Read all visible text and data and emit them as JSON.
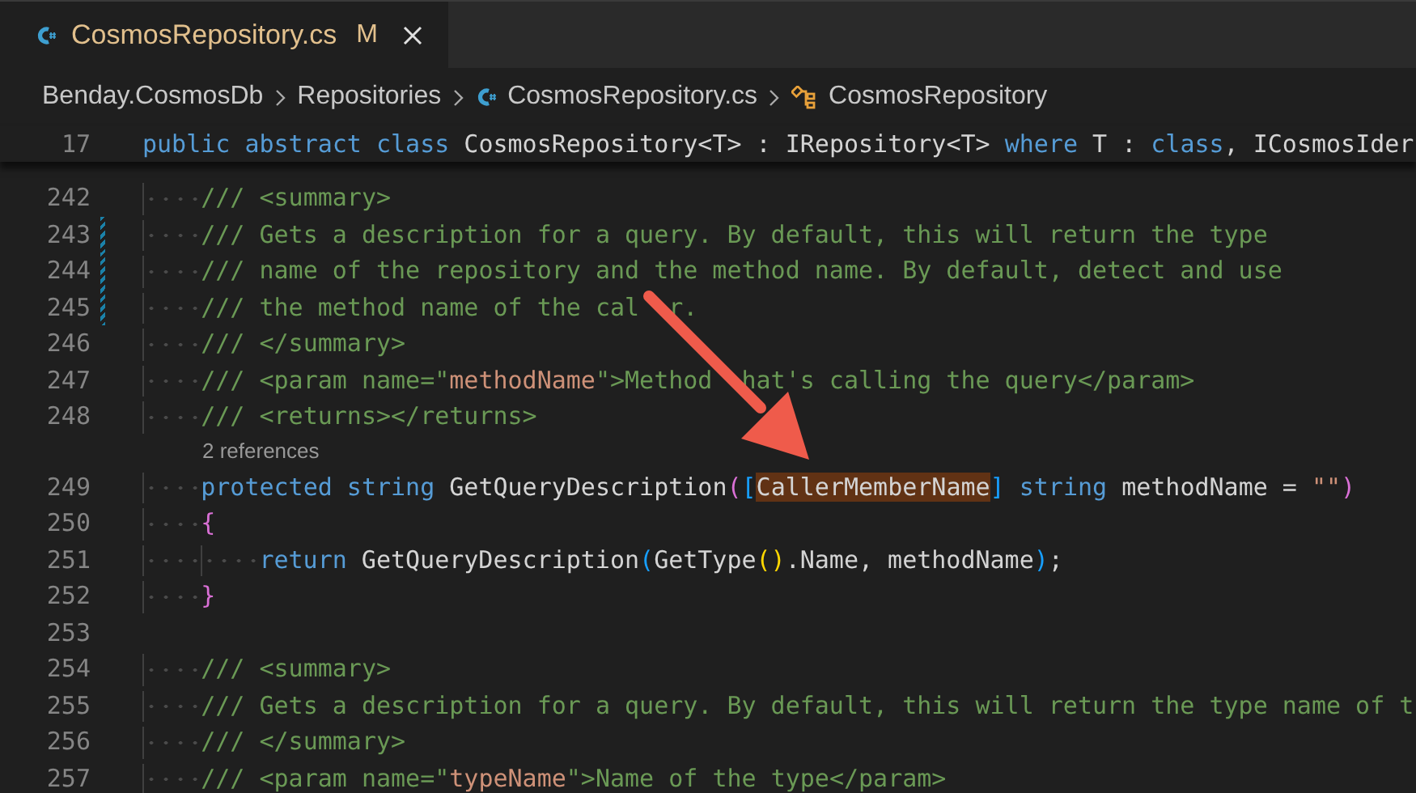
{
  "tab": {
    "label": "CosmosRepository.cs",
    "status": "M"
  },
  "breadcrumbs": [
    {
      "kind": "folder",
      "label": "Benday.CosmosDb"
    },
    {
      "kind": "folder",
      "label": "Repositories"
    },
    {
      "kind": "file",
      "label": "CosmosRepository.cs"
    },
    {
      "kind": "class",
      "label": "CosmosRepository"
    }
  ],
  "sticky_line": {
    "number": "17",
    "tokens": [
      {
        "kind": "keyword",
        "text": "public abstract class"
      },
      {
        "kind": "plain",
        "text": " CosmosRepository<T> : IRepository<T> "
      },
      {
        "kind": "keyword",
        "text": "where"
      },
      {
        "kind": "plain",
        "text": " T : "
      },
      {
        "kind": "keyword",
        "text": "class"
      },
      {
        "kind": "plain",
        "text": ", ICosmosIder"
      }
    ]
  },
  "lines": [
    {
      "number": "242",
      "modified": false,
      "tokens": [
        {
          "kind": "indent"
        },
        {
          "kind": "comment",
          "text": "/// <summary>"
        }
      ]
    },
    {
      "number": "243",
      "modified": true,
      "tokens": [
        {
          "kind": "indent"
        },
        {
          "kind": "comment",
          "text": "/// Gets a description for a query. By default, this will return the type"
        }
      ]
    },
    {
      "number": "244",
      "modified": true,
      "tokens": [
        {
          "kind": "indent"
        },
        {
          "kind": "comment",
          "text": "/// name of the repository and the method name. By default, detect and use"
        }
      ]
    },
    {
      "number": "245",
      "modified": true,
      "tokens": [
        {
          "kind": "indent"
        },
        {
          "kind": "comment",
          "text": "/// the method name of the cal"
        },
        {
          "kind": "covered"
        },
        {
          "kind": "covered"
        },
        {
          "kind": "comment",
          "text": "r."
        }
      ]
    },
    {
      "number": "246",
      "modified": false,
      "tokens": [
        {
          "kind": "indent"
        },
        {
          "kind": "comment",
          "text": "/// </summary>"
        }
      ]
    },
    {
      "number": "247",
      "modified": false,
      "tokens": [
        {
          "kind": "indent"
        },
        {
          "kind": "comment",
          "text": "/// <param name=\""
        },
        {
          "kind": "string",
          "text": "methodName"
        },
        {
          "kind": "comment",
          "text": "\">Method"
        },
        {
          "kind": "covered"
        },
        {
          "kind": "covered"
        },
        {
          "kind": "comment",
          "text": "hat's calling the query</param>"
        }
      ]
    },
    {
      "number": "248",
      "modified": false,
      "tokens": [
        {
          "kind": "indent"
        },
        {
          "kind": "comment",
          "text": "/// <returns></returns>"
        }
      ]
    },
    {
      "number": "249",
      "modified": false,
      "references": "2 references",
      "tokens": [
        {
          "kind": "indent"
        },
        {
          "kind": "keyword",
          "text": "protected string"
        },
        {
          "kind": "plain",
          "text": " GetQueryDescription"
        },
        {
          "kind": "brace",
          "text": "("
        },
        {
          "kind": "bracket",
          "text": "["
        },
        {
          "kind": "match",
          "text": "CallerMemberName"
        },
        {
          "kind": "bracket",
          "text": "]"
        },
        {
          "kind": "keyword",
          "text": " string"
        },
        {
          "kind": "plain",
          "text": " methodName = "
        },
        {
          "kind": "string",
          "text": "\"\""
        },
        {
          "kind": "brace",
          "text": ")"
        }
      ]
    },
    {
      "number": "250",
      "modified": false,
      "tokens": [
        {
          "kind": "indent"
        },
        {
          "kind": "brace",
          "text": "{"
        }
      ]
    },
    {
      "number": "251",
      "modified": false,
      "tokens": [
        {
          "kind": "indent"
        },
        {
          "kind": "indent"
        },
        {
          "kind": "keyword",
          "text": "return"
        },
        {
          "kind": "plain",
          "text": " GetQueryDescription"
        },
        {
          "kind": "bracket",
          "text": "("
        },
        {
          "kind": "plain",
          "text": "GetType"
        },
        {
          "kind": "paren",
          "text": "()"
        },
        {
          "kind": "plain",
          "text": ".Name, methodName"
        },
        {
          "kind": "bracket",
          "text": ")"
        },
        {
          "kind": "plain",
          "text": ";"
        }
      ]
    },
    {
      "number": "252",
      "modified": false,
      "tokens": [
        {
          "kind": "indent"
        },
        {
          "kind": "brace",
          "text": "}"
        }
      ]
    },
    {
      "number": "253",
      "modified": false
    },
    {
      "number": "254",
      "modified": false,
      "tokens": [
        {
          "kind": "indent"
        },
        {
          "kind": "comment",
          "text": "/// <summary>"
        }
      ]
    },
    {
      "number": "255",
      "modified": false,
      "tokens": [
        {
          "kind": "indent"
        },
        {
          "kind": "comment",
          "text": "/// Gets a description for a query. By default, this will return the type name of t"
        }
      ]
    },
    {
      "number": "256",
      "modified": false,
      "tokens": [
        {
          "kind": "indent"
        },
        {
          "kind": "comment",
          "text": "/// </summary>"
        }
      ]
    },
    {
      "number": "257",
      "modified": false,
      "tokens": [
        {
          "kind": "indent"
        },
        {
          "kind": "comment",
          "text": "/// <param name=\""
        },
        {
          "kind": "string",
          "text": "typeName"
        },
        {
          "kind": "comment",
          "text": "\">Name of the type</param>"
        }
      ]
    }
  ]
}
